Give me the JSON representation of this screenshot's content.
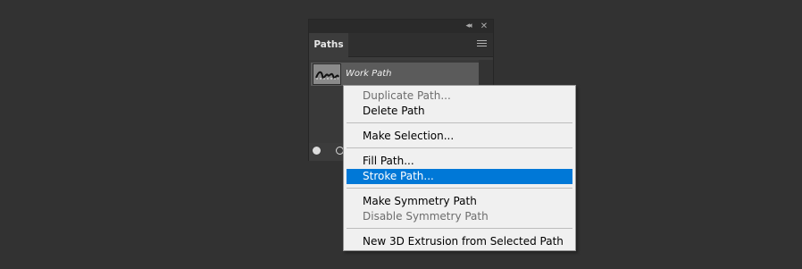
{
  "panel": {
    "tab_label": "Paths",
    "collapse_glyph": "◂◂",
    "close_glyph": "✕",
    "paths": [
      {
        "name": "Work Path",
        "selected": true
      }
    ],
    "footer_icons": [
      "fill-path-icon",
      "stroke-path-icon"
    ]
  },
  "context_menu": {
    "items": [
      {
        "label": "Duplicate Path...",
        "enabled": false
      },
      {
        "label": "Delete Path",
        "enabled": true
      },
      {
        "label": "Make Selection...",
        "enabled": true
      },
      {
        "label": "Fill Path...",
        "enabled": true
      },
      {
        "label": "Stroke Path...",
        "enabled": true,
        "highlighted": true
      },
      {
        "label": "Make Symmetry Path",
        "enabled": true
      },
      {
        "label": "Disable Symmetry Path",
        "enabled": false
      },
      {
        "label": "New 3D Extrusion from Selected Path",
        "enabled": true
      }
    ],
    "highlight_color": "#0078d7"
  }
}
